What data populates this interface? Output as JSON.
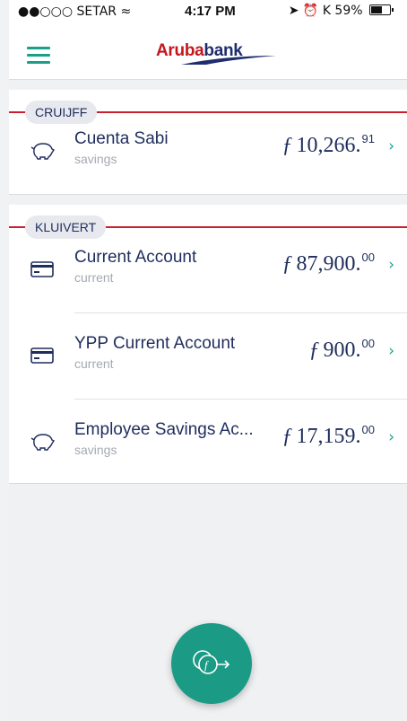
{
  "status_bar": {
    "carrier": "●●○○○ SETAR",
    "wifi": "wifi-icon",
    "time": "4:17 PM",
    "battery": "59%"
  },
  "header": {
    "logo_red": "Aruba",
    "logo_blue": "bank",
    "menu_icon": "hamburger-menu-icon"
  },
  "groups": [
    {
      "label": "CRUIJFF",
      "accounts": [
        {
          "name": "Cuenta Sabi",
          "type": "savings",
          "icon": "piggy-bank-icon",
          "currency": "ƒ",
          "amount": "10,266.",
          "cents": "91"
        }
      ]
    },
    {
      "label": "KLUIVERT",
      "accounts": [
        {
          "name": "Current Account",
          "type": "current",
          "icon": "credit-card-icon",
          "currency": "ƒ",
          "amount": "87,900.",
          "cents": "00"
        },
        {
          "name": "YPP Current Account",
          "type": "current",
          "icon": "credit-card-icon",
          "currency": "ƒ",
          "amount": "900.",
          "cents": "00"
        },
        {
          "name": "Employee Savings Ac...",
          "type": "savings",
          "icon": "piggy-bank-icon",
          "currency": "ƒ",
          "amount": "17,159.",
          "cents": "00"
        }
      ]
    }
  ],
  "chevron": "›",
  "fab": {
    "icon": "transfer-money-icon"
  },
  "colors": {
    "accent": "#1b9a85",
    "brand_red": "#c8202e",
    "text": "#1f2d5c"
  }
}
